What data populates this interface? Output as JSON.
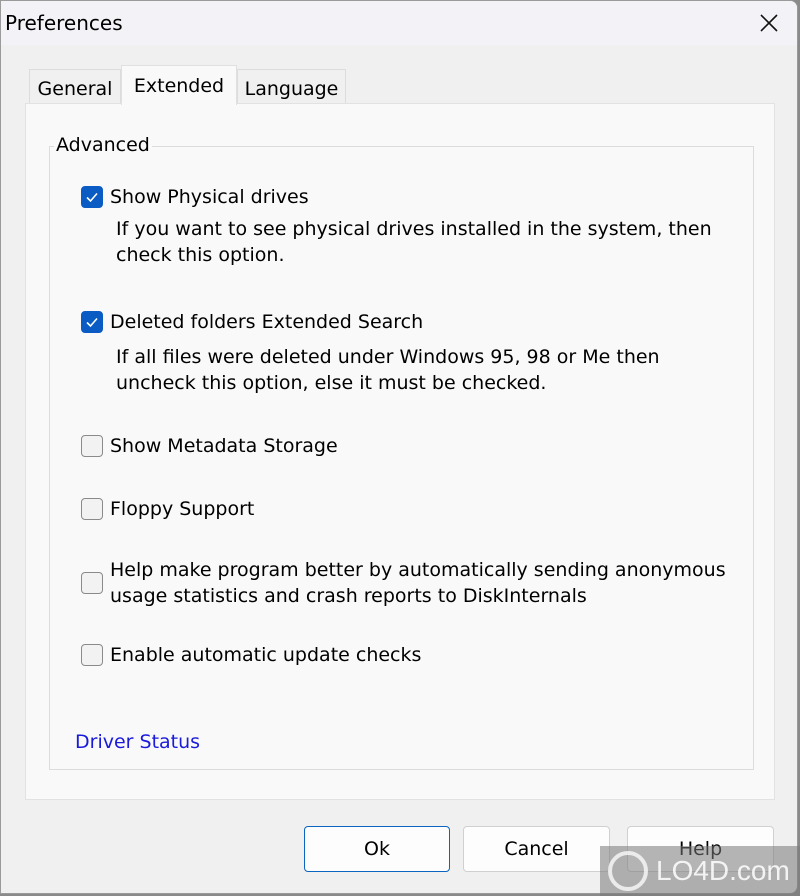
{
  "window": {
    "title": "Preferences",
    "close_icon": "close-icon"
  },
  "tabs": [
    {
      "label": "General",
      "active": false
    },
    {
      "label": "Extended",
      "active": true
    },
    {
      "label": "Language",
      "active": false
    }
  ],
  "group": {
    "label": "Advanced",
    "options": [
      {
        "label": "Show Physical drives",
        "checked": true,
        "description": [
          "If you want to see physical drives installed in the system, then",
          "check this option."
        ]
      },
      {
        "label": "Deleted folders Extended Search",
        "checked": true,
        "description": [
          "If all files were deleted under Windows 95, 98 or Me then",
          "uncheck this option, else it must be checked."
        ]
      },
      {
        "label": "Show Metadata Storage",
        "checked": false
      },
      {
        "label": "Floppy Support",
        "checked": false
      },
      {
        "label": "Help make program better by automatically sending anonymous usage statistics and crash reports to DiskInternals",
        "checked": false
      },
      {
        "label": "Enable automatic update checks",
        "checked": false
      }
    ],
    "link": "Driver Status"
  },
  "buttons": {
    "ok": "Ok",
    "cancel": "Cancel",
    "help": "Help"
  },
  "watermark": "LO4D.com",
  "colors": {
    "accent": "#0a5bc4",
    "link": "#1a1adb"
  }
}
